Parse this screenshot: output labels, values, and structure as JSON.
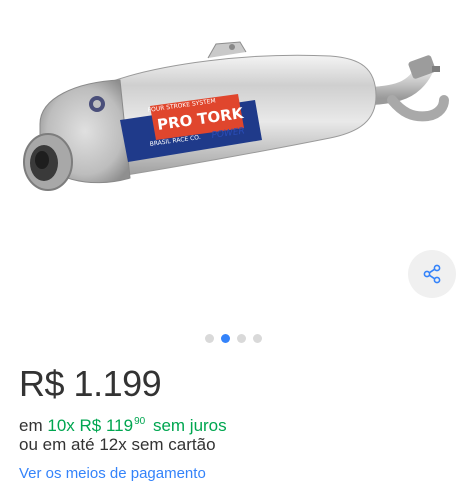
{
  "product": {
    "image_alt": "Exhaust muffler product photo",
    "decal": {
      "top_text": "FOUR STROKE SYSTEM",
      "brand": "PRO TORK",
      "bottom_text": "BRASIL RACE CO.",
      "power": "POWER"
    }
  },
  "gallery": {
    "total_images": 4,
    "active_index": 1
  },
  "price": {
    "currency": "R$",
    "amount": "1.199"
  },
  "installments": {
    "prefix": "em",
    "count": "10x",
    "currency": "R$",
    "amount": "119",
    "cents": "90",
    "suffix": "sem juros"
  },
  "alt_installments": "ou em até 12x sem cartão",
  "payment_link": "Ver os meios de pagamento",
  "colors": {
    "accent": "#3483fa",
    "green": "#00a650",
    "text": "#333333"
  }
}
